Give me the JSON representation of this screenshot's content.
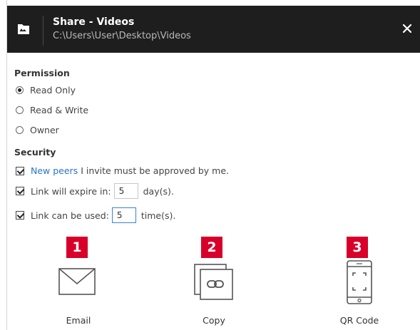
{
  "window": {
    "title": "Share - Videos",
    "path": "C:\\Users\\User\\Desktop\\Videos"
  },
  "permission": {
    "heading": "Permission",
    "options": [
      {
        "label": "Read Only",
        "selected": true
      },
      {
        "label": "Read & Write",
        "selected": false
      },
      {
        "label": "Owner",
        "selected": false
      }
    ]
  },
  "security": {
    "heading": "Security",
    "approve": {
      "checked": true,
      "link_text": "New peers",
      "text": "I invite must be approved by me."
    },
    "expire": {
      "checked": true,
      "label": "Link will expire in:",
      "value": "5",
      "unit": "day(s)."
    },
    "uses": {
      "checked": true,
      "label": "Link can be used:",
      "value": "5",
      "unit": "time(s)."
    }
  },
  "share_options": [
    {
      "badge": "1",
      "label": "Email",
      "icon": "envelope-icon"
    },
    {
      "badge": "2",
      "label": "Copy",
      "icon": "copy-link-icon"
    },
    {
      "badge": "3",
      "label": "QR Code",
      "icon": "qr-phone-icon"
    }
  ],
  "colors": {
    "titlebar": "#1e1e1e",
    "link": "#2a74c9",
    "badge": "#d8002a",
    "focus": "#3a82d6"
  }
}
